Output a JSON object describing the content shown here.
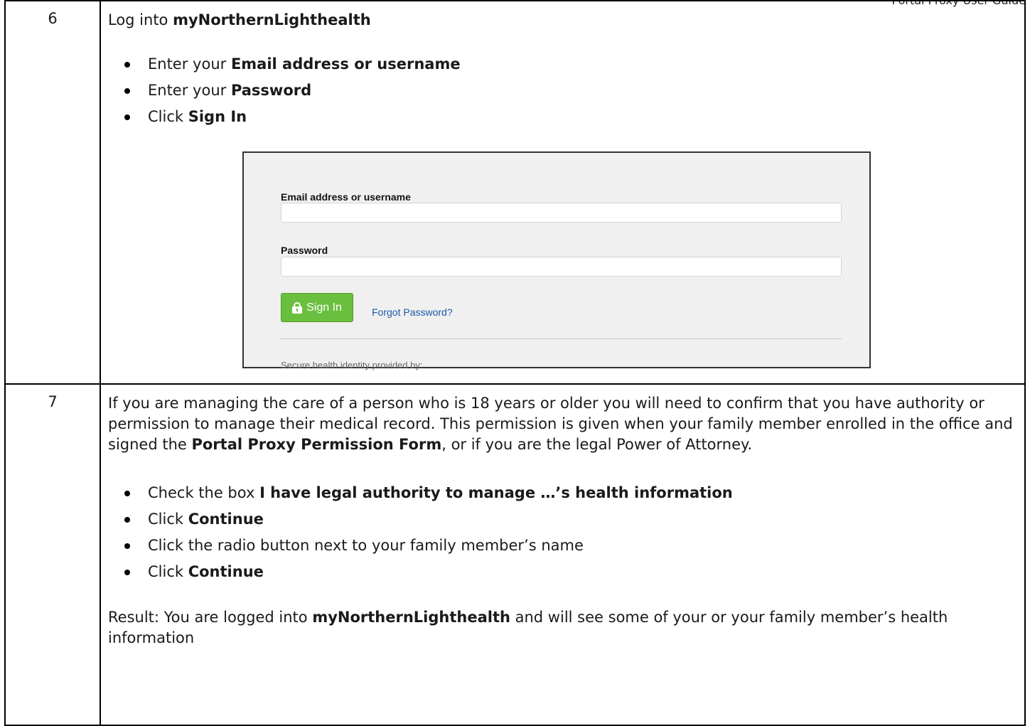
{
  "header_clip": "Portal Proxy User Guide",
  "step6": {
    "number": "6",
    "intro_prefix": "Log into ",
    "portal_name": "myNorthernLighthealth",
    "bullets": [
      {
        "prefix": "Enter your ",
        "bold": "Email address or username"
      },
      {
        "prefix": "Enter your ",
        "bold": "Password"
      },
      {
        "prefix": "Click ",
        "bold": "Sign In"
      }
    ],
    "login": {
      "email_label": "Email address or username",
      "email_value": "",
      "password_label": "Password",
      "password_value": "",
      "signin_button": "Sign In",
      "forgot_link": "Forgot Password?",
      "footer": "Secure health identity provided by:"
    }
  },
  "step7": {
    "number": "7",
    "para_1": "If you are managing the care of a person who is 18 years or older you will need to confirm that you have authority or permission to manage their medical record. This permission is given when your family member enrolled in the office and signed the ",
    "para_bold": "Portal Proxy Permission Form",
    "para_2": ", or if you are the legal Power of Attorney.",
    "bullets": [
      {
        "prefix": "Check the box ",
        "bold": "I have legal authority to manage …’s health information"
      },
      {
        "prefix": "Click ",
        "bold": "Continue"
      },
      {
        "prefix": "Click the radio button next to your family member’s name",
        "bold": ""
      },
      {
        "prefix": "Click ",
        "bold": "Continue"
      }
    ],
    "result_prefix": "Result:  You are logged into ",
    "result_bold": "myNorthernLighthealth",
    "result_suffix": " and will see some of your or your family member’s health information"
  }
}
